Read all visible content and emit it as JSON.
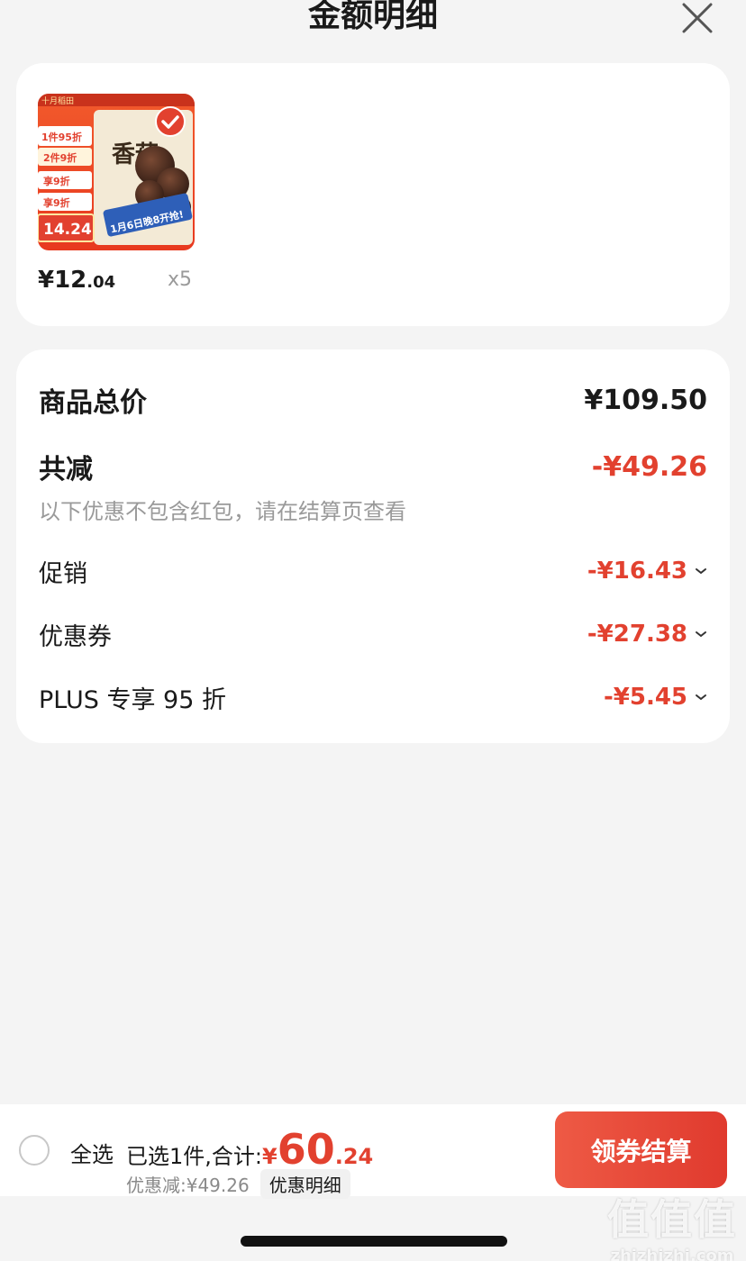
{
  "header": {
    "title": "金额明细"
  },
  "product": {
    "price_int": "¥12",
    "price_dec": ".04",
    "quantity": "x5",
    "thumbnail": {
      "promo_lines": [
        "十月稻田",
        "1件95折",
        "2件9折",
        "享9折",
        "享9折",
        "14.24"
      ],
      "brand_text": "香菇",
      "date_banner": "1月6日晚8开抢!"
    }
  },
  "summary": {
    "total_label": "商品总价",
    "total_value": "¥109.50",
    "reduce_label": "共减",
    "reduce_value": "-¥49.26",
    "reduce_note": "以下优惠不包含红包，请在结算页查看",
    "details": [
      {
        "label": "促销",
        "value": "-¥16.43"
      },
      {
        "label": "优惠券",
        "value": "-¥27.38"
      },
      {
        "label": "PLUS 专享 95 折",
        "value": "-¥5.45"
      }
    ]
  },
  "bottom_bar": {
    "select_all": "全选",
    "selected_text": "已选1件,合计:",
    "total_currency": "¥",
    "total_int": "60",
    "total_dec": ".24",
    "discount_text": "优惠减:¥49.26",
    "detail_link": "优惠明细",
    "checkout_label": "领券结算"
  },
  "watermark": {
    "cn": "值值值",
    "en": "zhizhizhi.com"
  },
  "colors": {
    "accent": "#e2412f",
    "background": "#f4f4f4",
    "card": "#ffffff"
  }
}
